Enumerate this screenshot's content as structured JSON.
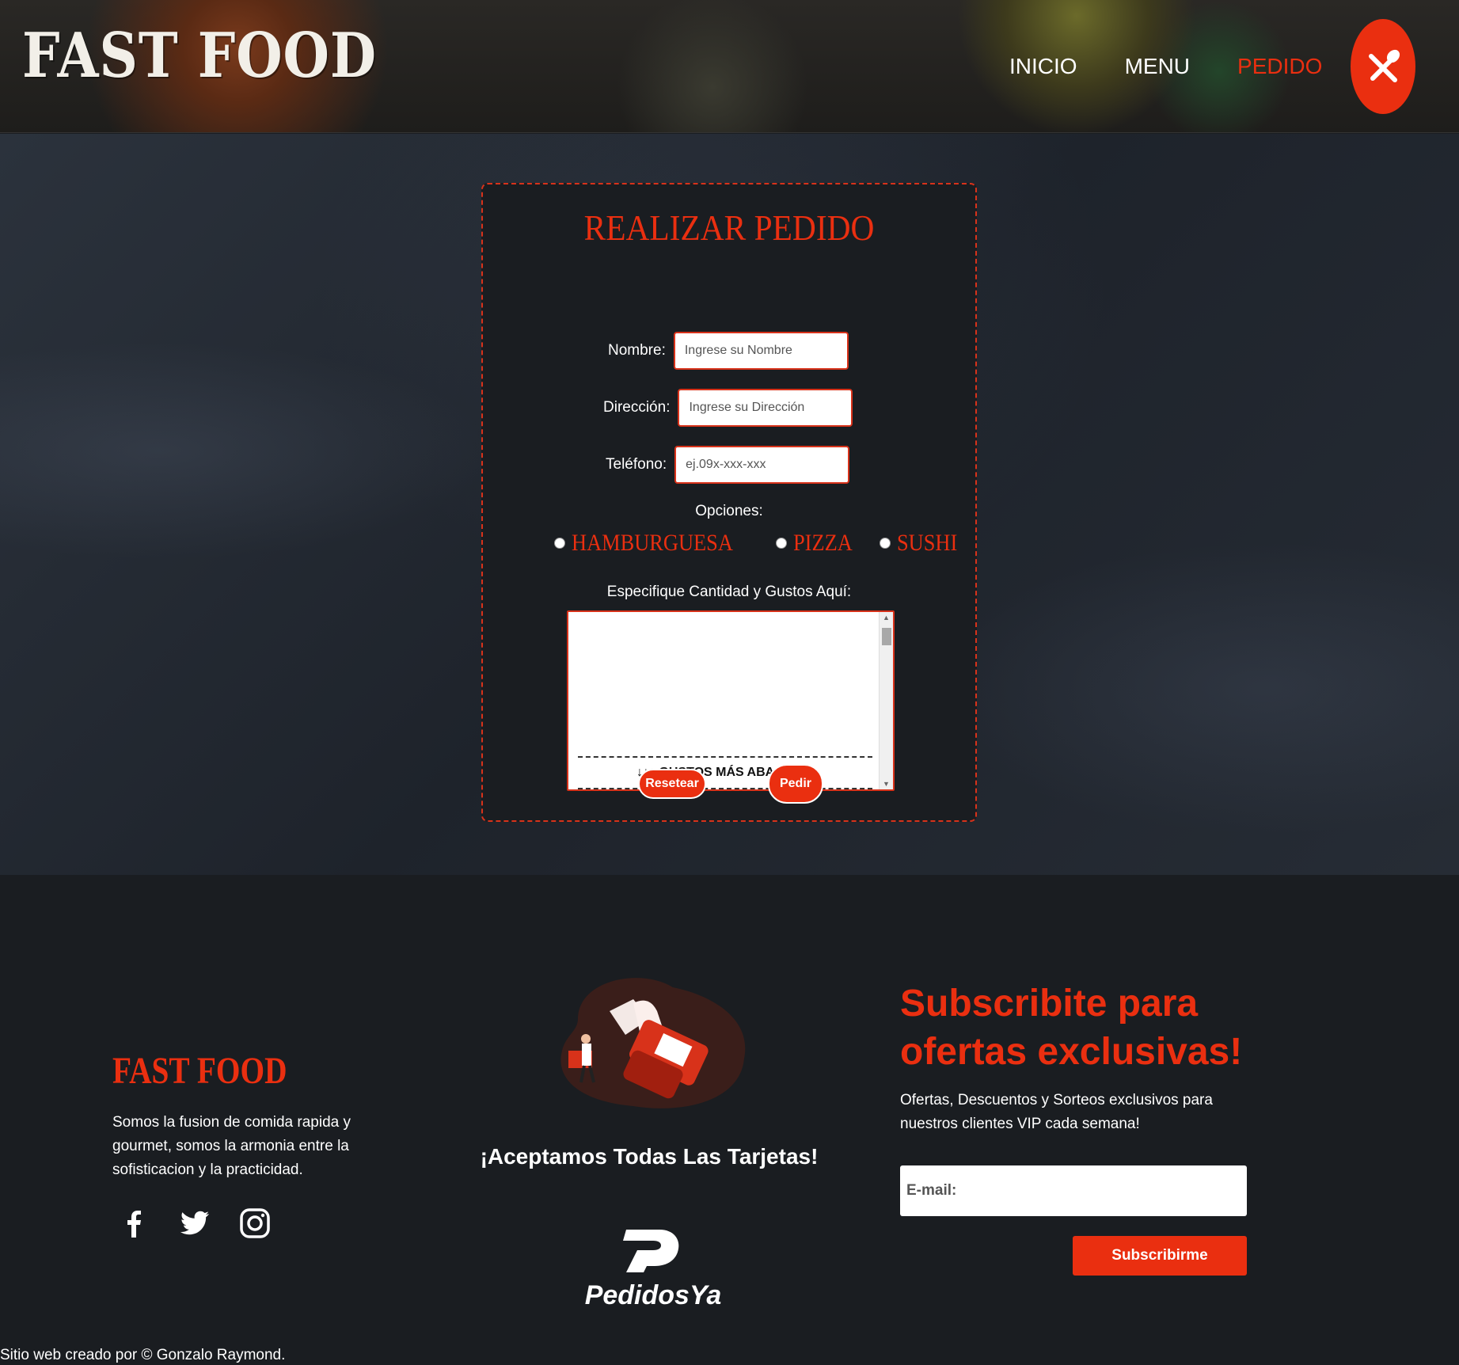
{
  "header": {
    "logo": "FAST FOOD",
    "nav": [
      {
        "label": "INICIO"
      },
      {
        "label": "MENU"
      },
      {
        "label": "PEDIDO",
        "active": true
      }
    ]
  },
  "form": {
    "title": "REALIZAR PEDIDO",
    "fields": {
      "nombre": {
        "label": "Nombre:",
        "placeholder": "Ingrese su Nombre"
      },
      "direccion": {
        "label": "Dirección:",
        "placeholder": "Ingrese su Dirección"
      },
      "telefono": {
        "label": "Teléfono:",
        "placeholder": "ej.09x-xxx-xxx"
      }
    },
    "options_label": "Opciones:",
    "options": [
      "HAMBURGUESA",
      "PIZZA",
      "SUSHI"
    ],
    "spec_label": "Especifique Cantidad y Gustos Aquí:",
    "textarea_text": "↓↓↓ GUSTOS MÁS ABAJO ↓↓↓",
    "reset_label": "Resetear",
    "submit_label": "Pedir"
  },
  "footer": {
    "logo": "FAST FOOD",
    "description": "Somos la fusion de comida rapida y gourmet, somos la armonia entre la sofisticacion y la practicidad.",
    "cards_text": "¡Aceptamos Todas Las Tarjetas!",
    "partner": "PedidosYa",
    "subscribe_title": "Subscribite para ofertas exclusivas!",
    "subscribe_desc": "Ofertas, Descuentos y Sorteos exclusivos para nuestros clientes VIP cada semana!",
    "email_placeholder": "E-mail:",
    "subscribe_button": "Subscribirme",
    "credit": "Sitio web creado por © Gonzalo Raymond."
  },
  "colors": {
    "accent": "#ea2f10",
    "background": "#1a1d21"
  },
  "icons": [
    "utensils-icon",
    "facebook-icon",
    "twitter-icon",
    "instagram-icon",
    "payment-terminal-illustration",
    "pedidosya-logo"
  ]
}
